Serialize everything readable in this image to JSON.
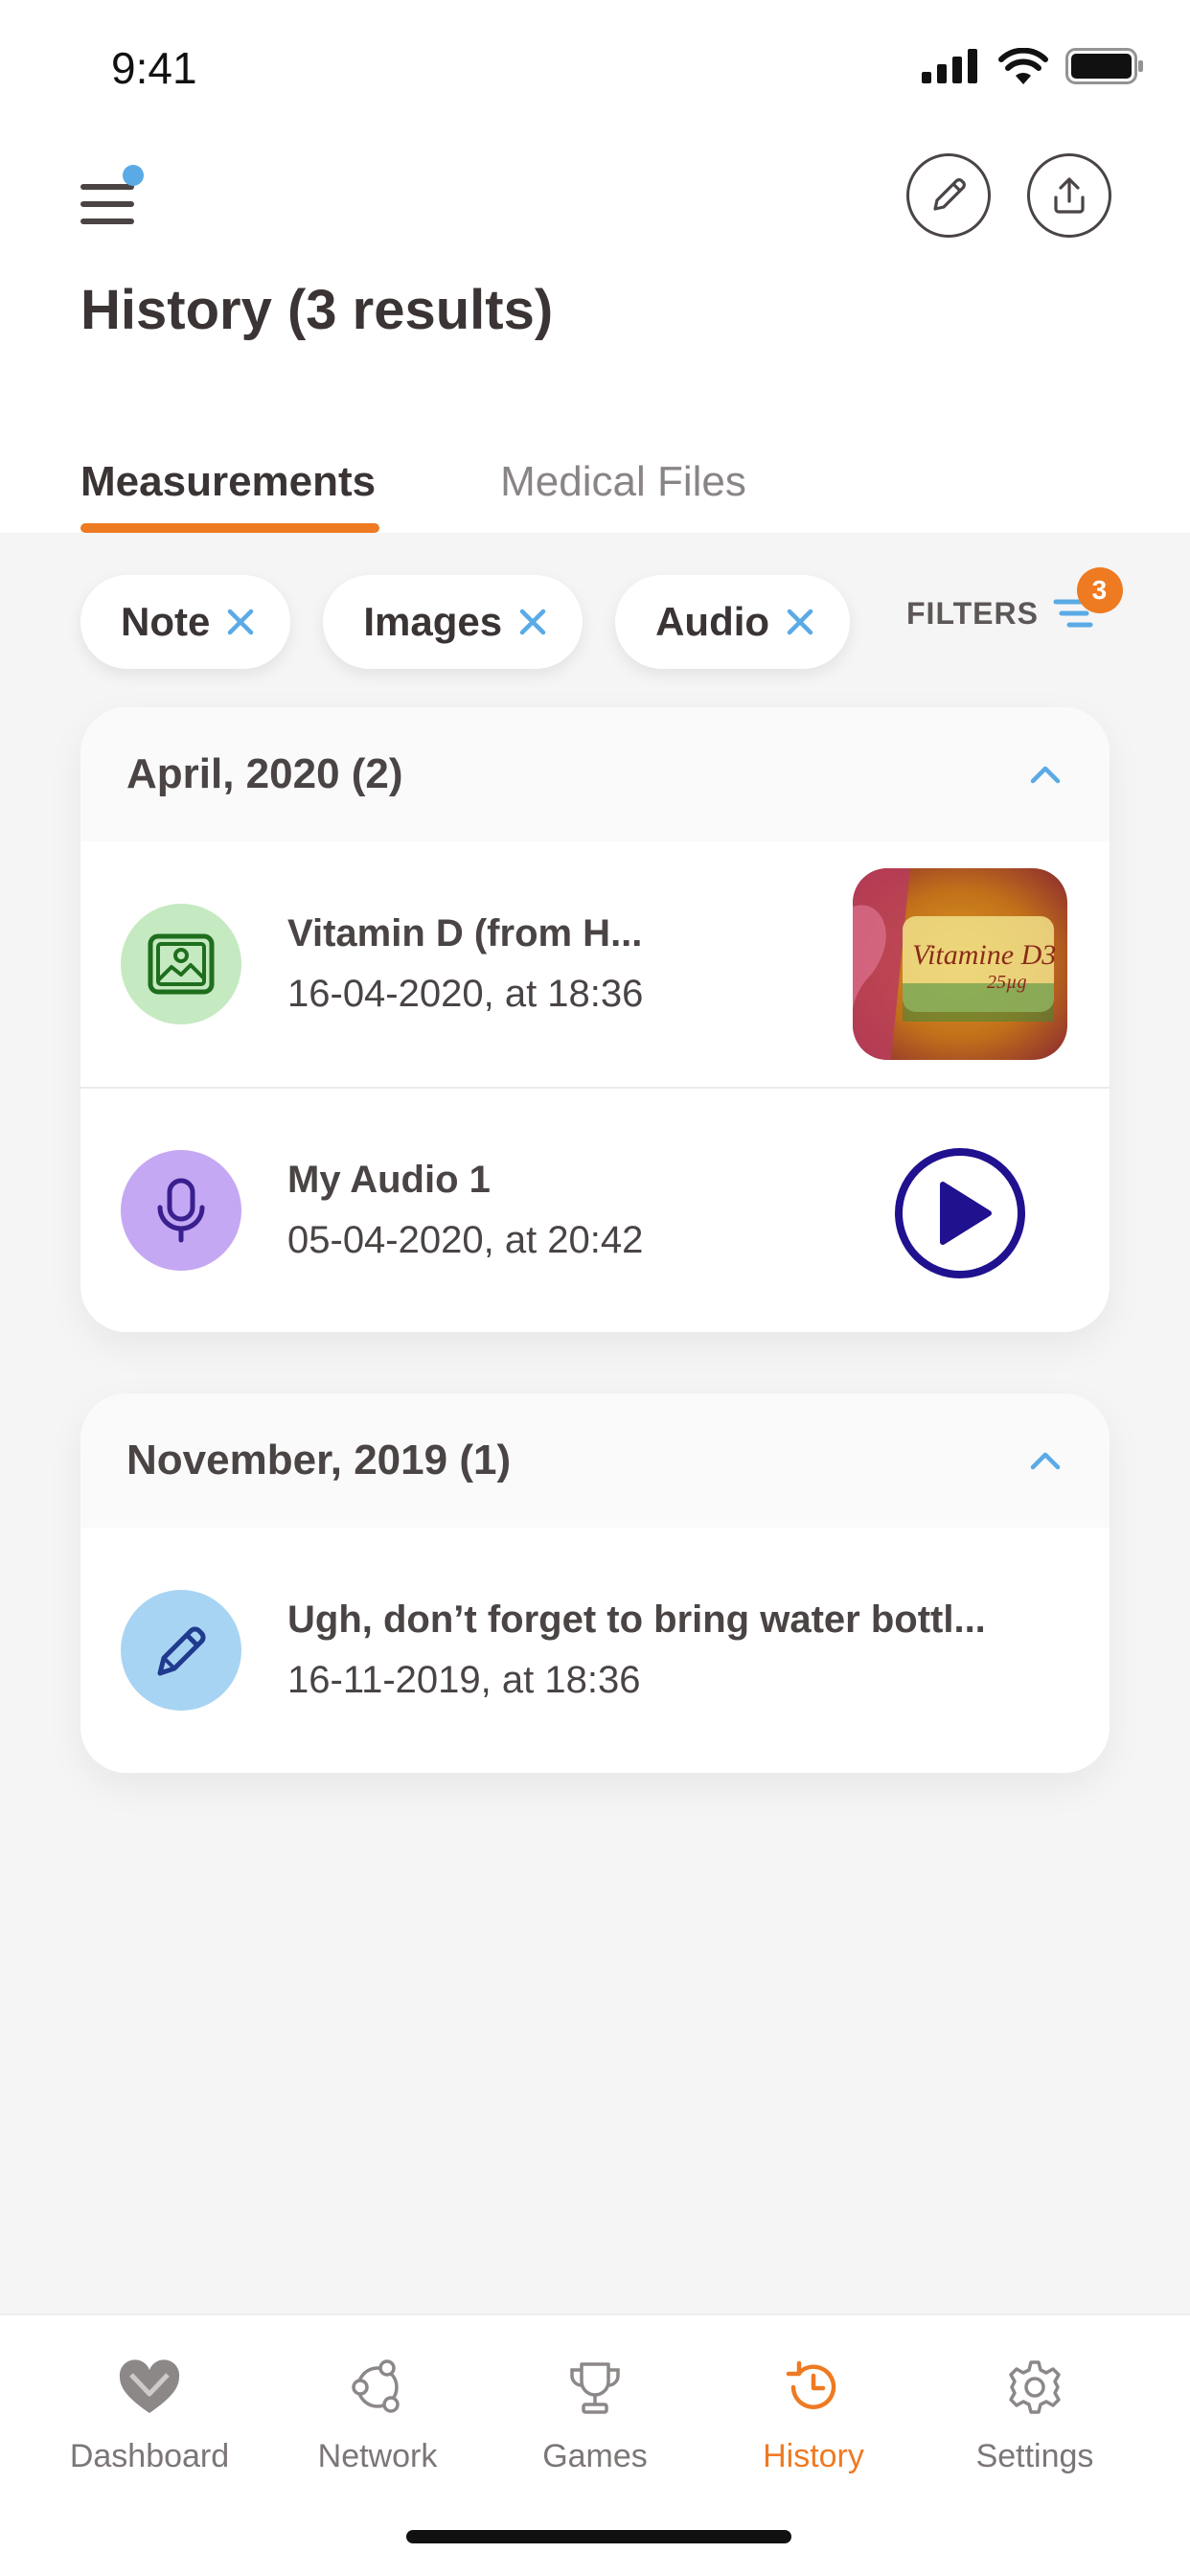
{
  "status_bar": {
    "time": "9:41"
  },
  "header": {
    "title": "History (3 results)",
    "menu_icon": "hamburger-menu-icon",
    "edit_icon": "pencil-icon",
    "share_icon": "share-upload-icon"
  },
  "tabs": [
    {
      "label": "Measurements",
      "active": true
    },
    {
      "label": "Medical Files",
      "active": false
    }
  ],
  "filters": {
    "chips": [
      {
        "label": "Note"
      },
      {
        "label": "Images"
      },
      {
        "label": "Audio"
      }
    ],
    "label": "FILTERS",
    "count": "3"
  },
  "groups": [
    {
      "title": "April, 2020 (2)",
      "items": [
        {
          "title": "Vitamin D (from H...",
          "subtitle": "16-04-2020, at 18:36",
          "type": "image",
          "thumb_text": "Vitamine D3",
          "thumb_sub": "25µg"
        },
        {
          "title": "My Audio 1",
          "subtitle": "05-04-2020, at 20:42",
          "type": "audio"
        }
      ]
    },
    {
      "title": "November, 2019 (1)",
      "items": [
        {
          "title": "Ugh, don’t forget to bring water bottl...",
          "subtitle": "16-11-2019, at 18:36",
          "type": "note"
        }
      ]
    }
  ],
  "bottom_nav": [
    {
      "label": "Dashboard",
      "icon": "heart-icon",
      "active": false
    },
    {
      "label": "Network",
      "icon": "network-icon",
      "active": false
    },
    {
      "label": "Games",
      "icon": "trophy-icon",
      "active": false
    },
    {
      "label": "History",
      "icon": "history-clock-icon",
      "active": true
    },
    {
      "label": "Settings",
      "icon": "gear-icon",
      "active": false
    }
  ],
  "colors": {
    "accent": "#ee7a22",
    "chip_x": "#5aaae6",
    "image_icon_bg": "#c5e9c0",
    "audio_icon_bg": "#c5a8f3",
    "note_icon_bg": "#a8d4f3",
    "play_button": "#20118f"
  }
}
